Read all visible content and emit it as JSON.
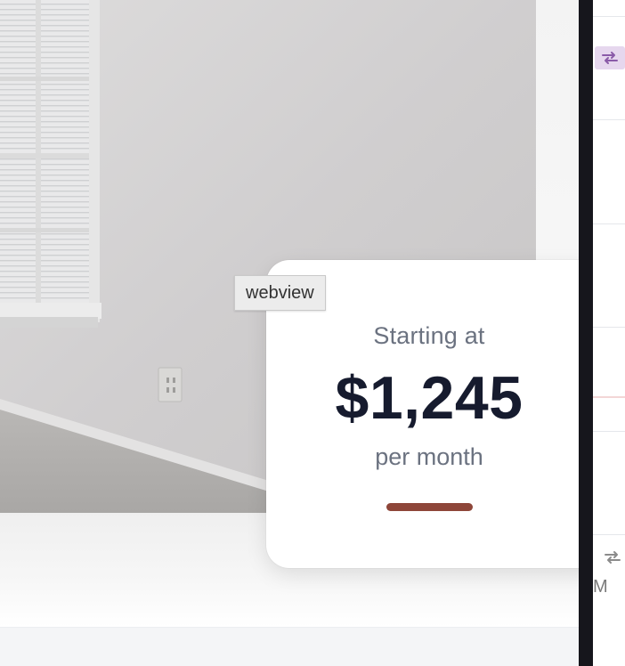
{
  "tooltip": {
    "text": "webview"
  },
  "price_card": {
    "lead": "Starting at",
    "amount": "$1,245",
    "period": "per month",
    "accent_color": "#8e4639"
  },
  "side_panel": {
    "icons": [
      "repeat-icon",
      "repeat-icon"
    ],
    "partial_text": "M"
  },
  "colors": {
    "divider": "#16161c",
    "badge": "#e6d7ee",
    "amount_text": "#161b2e",
    "muted_text": "#6b7280"
  }
}
